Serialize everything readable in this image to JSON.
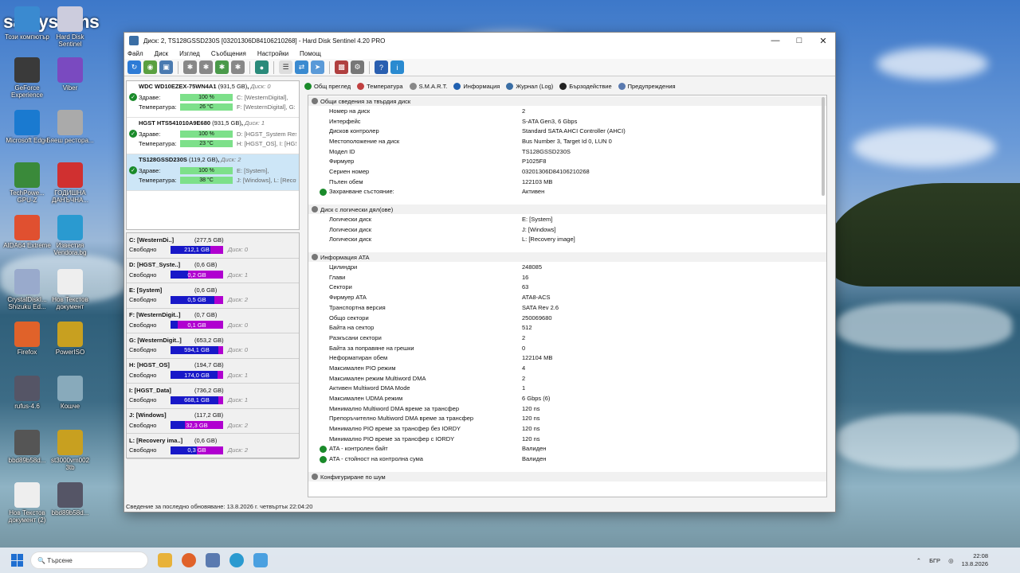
{
  "desktop": {
    "brand": "satsystems",
    "icons": [
      {
        "label": "Този компютър"
      },
      {
        "label": "Hard Disk Sentinel"
      },
      {
        "label": "GeForce Experience"
      },
      {
        "label": "Viber"
      },
      {
        "label": "Microsoft Edge"
      },
      {
        "label": "Бяеш ресторa..."
      },
      {
        "label": "TechPowe... GPU-Z"
      },
      {
        "label": "ГОДИШНА ДАНЪЧНА..."
      },
      {
        "label": "AIDA64 Extreme"
      },
      {
        "label": "Известия Vendora.bg"
      },
      {
        "label": "CrystalDiskI... Shizuku Ed..."
      },
      {
        "label": "Нов Текстов документ"
      },
      {
        "label": "Firefox"
      },
      {
        "label": "PowerISO"
      },
      {
        "label": "rufus-4.6"
      },
      {
        "label": "Кошче"
      },
      {
        "label": "bbd89b58d..."
      },
      {
        "label": "st3000vm002 3tb"
      },
      {
        "label": "Нов Текстов документ (2)"
      },
      {
        "label": "bbd89b58d..."
      }
    ]
  },
  "window": {
    "title": "Диск: 2, TS128GSSD230S [03201306D84106210268]  -  Hard Disk Sentinel 4.20 PRO",
    "menu": [
      "Файл",
      "Диск",
      "Изглед",
      "Съобщения",
      "Настройки",
      "Помощ"
    ],
    "toolbar_icons": [
      "refresh-icon",
      "speed-icon",
      "report-icon",
      "fan-icon",
      "fan-icon",
      "fan-icon",
      "fan-icon",
      "globe-icon",
      "doc-icon",
      "network-icon",
      "send-icon",
      "chart-icon",
      "settings-icon",
      "help-icon",
      "info-icon"
    ]
  },
  "disks": [
    {
      "name": "WDC WD10EZEX-75WN4A1",
      "size": "(931,5 GB)",
      "disk": "Диск: 0",
      "health_label": "Здраве:",
      "health": "100 %",
      "temp_label": "Температура:",
      "temp": "26 °C",
      "info1": "C: [WesternDigital],",
      "info2": "F: [WesternDigital], G: [WesternD..."
    },
    {
      "name": "HGST HTS541010A9E680",
      "size": "(931,5 GB)",
      "disk": "Диск: 1",
      "health_label": "Здраве:",
      "health": "100 %",
      "temp_label": "Температура:",
      "temp": "23 °C",
      "info1": "D: [HGST_System Reserved],",
      "info2": "H: [HGST_OS], I: [HGST_Data]"
    },
    {
      "name": "TS128GSSD230S",
      "size": "(119,2 GB)",
      "disk": "Диск: 2",
      "health_label": "Здраве:",
      "health": "100 %",
      "temp_label": "Температура:",
      "temp": "38 °C",
      "info1": "E: [System],",
      "info2": "J: [Windows], L: [Recovery image]"
    }
  ],
  "volumes": [
    {
      "name": "C: [WesternDi..]",
      "size": "(277,5 GB)",
      "free_label": "Свободно",
      "free": "212,1 GB",
      "used_pct": 24,
      "disk": "Диск: 0"
    },
    {
      "name": "D: [HGST_Syste..]",
      "size": "(0,6 GB)",
      "free_label": "Свободно",
      "free": "0,2 GB",
      "used_pct": 67,
      "disk": "Диск: 1"
    },
    {
      "name": "E: [System]",
      "size": "(0,6 GB)",
      "free_label": "Свободно",
      "free": "0,5 GB",
      "used_pct": 17,
      "disk": "Диск: 2"
    },
    {
      "name": "F: [WesternDigit..]",
      "size": "(0,7 GB)",
      "free_label": "Свободно",
      "free": "0,1 GB",
      "used_pct": 86,
      "disk": "Диск: 0"
    },
    {
      "name": "G: [WesternDigit..]",
      "size": "(653,2 GB)",
      "free_label": "Свободно",
      "free": "594,1 GB",
      "used_pct": 9,
      "disk": "Диск: 0"
    },
    {
      "name": "H: [HGST_OS]",
      "size": "(194,7 GB)",
      "free_label": "Свободно",
      "free": "174,0 GB",
      "used_pct": 11,
      "disk": "Диск: 1"
    },
    {
      "name": "I: [HGST_Data]",
      "size": "(736,2 GB)",
      "free_label": "Свободно",
      "free": "668,1 GB",
      "used_pct": 9,
      "disk": "Диск: 1"
    },
    {
      "name": "J: [Windows]",
      "size": "(117,2 GB)",
      "free_label": "Свободно",
      "free": "32,3 GB",
      "used_pct": 72,
      "disk": "Диск: 2"
    },
    {
      "name": "L: [Recovery ima..]",
      "size": "(0,6 GB)",
      "free_label": "Свободно",
      "free": "0,3 GB",
      "used_pct": 50,
      "disk": "Диск: 2"
    }
  ],
  "tabs": [
    {
      "label": "Общ преглед",
      "color": "#1a8a2a"
    },
    {
      "label": "Температура",
      "color": "#c04040"
    },
    {
      "label": "S.M.A.R.T.",
      "color": "#888888"
    },
    {
      "label": "Информация",
      "color": "#2060b0"
    },
    {
      "label": "Журнал (Log)",
      "color": "#3a6ea5"
    },
    {
      "label": "Бързодействие",
      "color": "#222222"
    },
    {
      "label": "Предупреждения",
      "color": "#5a7ab0"
    }
  ],
  "info": {
    "general_title": "Общи сведения за твърдия диск",
    "general": [
      {
        "k": "Номер на диск",
        "v": "2"
      },
      {
        "k": "Интерфейс",
        "v": "S-ATA Gen3, 6 Gbps"
      },
      {
        "k": "Дисков контролер",
        "v": "Standard SATA AHCI Controller (AHCI)"
      },
      {
        "k": "Местоположение на диск",
        "v": "Bus Number 3, Target Id 0, LUN 0"
      },
      {
        "k": "Модел ID",
        "v": "TS128GSSD230S"
      },
      {
        "k": "Фирмуер",
        "v": "P1025F8"
      },
      {
        "k": "Сериен номер",
        "v": "03201306D84106210268"
      },
      {
        "k": "Пълен обем",
        "v": "122103 MB"
      },
      {
        "k": "Захранване състояние:",
        "v": "Активен"
      }
    ],
    "logical_title": "Диск с логически дял(ове)",
    "logical": [
      {
        "k": "Логически диск",
        "v": "E: [System]"
      },
      {
        "k": "Логически диск",
        "v": "J: [Windows]"
      },
      {
        "k": "Логически диск",
        "v": "L: [Recovery image]"
      }
    ],
    "ata_title": "Информация ATA",
    "ata": [
      {
        "k": "Цилиндри",
        "v": "248085"
      },
      {
        "k": "Глави",
        "v": "16"
      },
      {
        "k": "Сектори",
        "v": "63"
      },
      {
        "k": "Фирмуер ATA",
        "v": "ATA8-ACS"
      },
      {
        "k": "Транспортна версия",
        "v": "SATA Rev 2.6"
      },
      {
        "k": "Общо сектори",
        "v": "250069680"
      },
      {
        "k": "Байта на сектор",
        "v": "512"
      },
      {
        "k": "Разкъсани сектори",
        "v": "2"
      },
      {
        "k": "Байта за поправяне на грешки",
        "v": "0"
      },
      {
        "k": "Неформатиран обем",
        "v": "122104 MB"
      },
      {
        "k": "Максимален PIO режим",
        "v": "4"
      },
      {
        "k": "Максимален режим Multiword DMA",
        "v": "2"
      },
      {
        "k": "Активен Multiword DMA Mode",
        "v": "1"
      },
      {
        "k": "Максимален UDMA режим",
        "v": "6 Gbps (6)"
      },
      {
        "k": "Минимално Multiword DMA време за трансфер",
        "v": "120 ns"
      },
      {
        "k": "Препоръчително Multiword DMA време за трансфер",
        "v": "120 ns"
      },
      {
        "k": "Минимално PIO време за трансфер без IORDY",
        "v": "120 ns"
      },
      {
        "k": "Минимално PIO време за трансфер с IORDY",
        "v": "120 ns"
      },
      {
        "k": "ATA - контролен байт",
        "v": "Валиден"
      },
      {
        "k": "ATA - стойност на контролна сума",
        "v": "Валиден"
      }
    ],
    "noise_title": "Конфигуриране по шум"
  },
  "status": "Сведение за последно обновяване: 13.8.2026 г. четвъртък 22:04:20",
  "taskbar": {
    "search_placeholder": "Търсене",
    "lang": "БГР",
    "time": "22:08",
    "date": "13.8.2026"
  }
}
